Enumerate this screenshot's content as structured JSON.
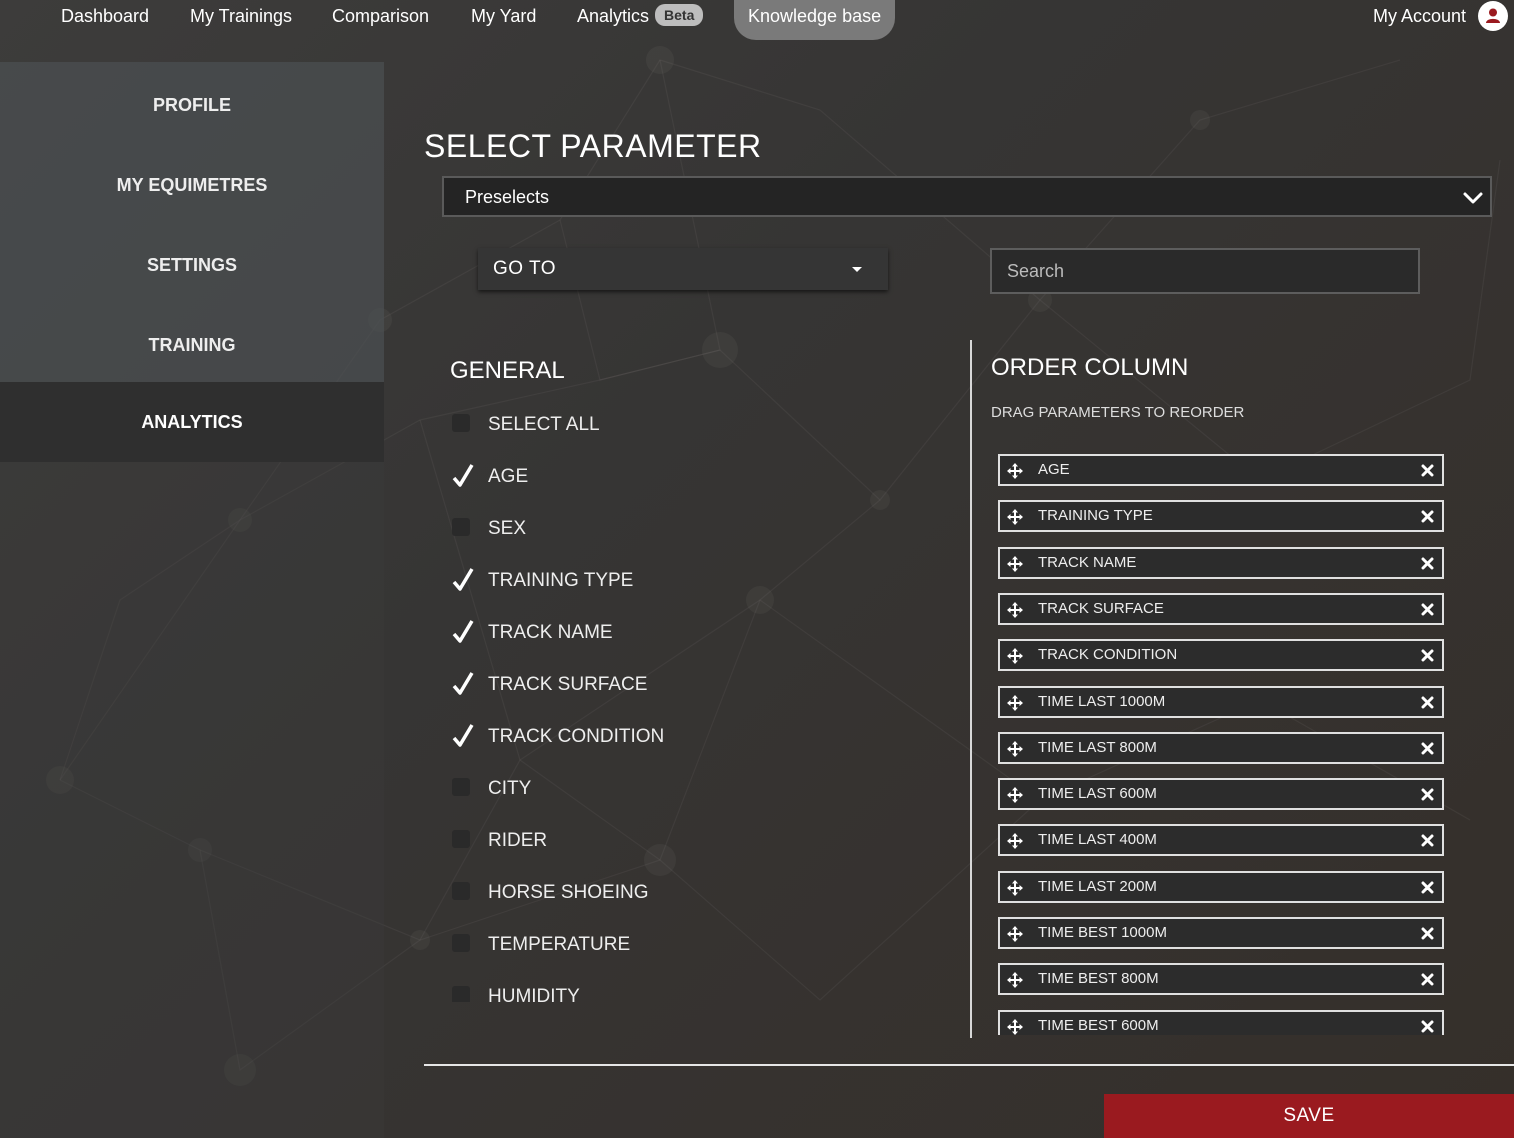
{
  "nav": {
    "items": [
      {
        "label": "Dashboard"
      },
      {
        "label": "My Trainings"
      },
      {
        "label": "Comparison"
      },
      {
        "label": "My Yard"
      },
      {
        "label": "Analytics",
        "badge": "Beta"
      },
      {
        "label": "Knowledge base"
      }
    ],
    "account_label": "My Account"
  },
  "sidebar": {
    "items": [
      {
        "label": "PROFILE"
      },
      {
        "label": "MY EQUIMETRES"
      },
      {
        "label": "SETTINGS"
      },
      {
        "label": "TRAINING"
      },
      {
        "label": "ANALYTICS"
      }
    ]
  },
  "main": {
    "title": "SELECT PARAMETER",
    "preselect": "Preselects",
    "goto": "GO TO",
    "search_placeholder": "Search",
    "general_title": "GENERAL",
    "general_items": [
      {
        "label": "SELECT ALL",
        "checked": false
      },
      {
        "label": "AGE",
        "checked": true
      },
      {
        "label": "SEX",
        "checked": false
      },
      {
        "label": "TRAINING TYPE",
        "checked": true
      },
      {
        "label": "TRACK NAME",
        "checked": true
      },
      {
        "label": "TRACK SURFACE",
        "checked": true
      },
      {
        "label": "TRACK CONDITION",
        "checked": true
      },
      {
        "label": "CITY",
        "checked": false
      },
      {
        "label": "RIDER",
        "checked": false
      },
      {
        "label": "HORSE SHOEING",
        "checked": false
      },
      {
        "label": "TEMPERATURE",
        "checked": false
      },
      {
        "label": "HUMIDITY",
        "checked": false
      }
    ],
    "order_title": "ORDER COLUMN",
    "order_subtitle": "DRAG PARAMETERS TO REORDER",
    "order_items": [
      "AGE",
      "TRAINING TYPE",
      "TRACK NAME",
      "TRACK SURFACE",
      "TRACK CONDITION",
      "TIME LAST 1000M",
      "TIME LAST 800M",
      "TIME LAST 600M",
      "TIME LAST 400M",
      "TIME LAST 200M",
      "TIME BEST 1000M",
      "TIME BEST 800M",
      "TIME BEST 600M"
    ],
    "save_label": "SAVE"
  },
  "colors": {
    "accent": "#9a1a1f",
    "active_tab": "#7a7a7a",
    "account_icon": "#9a1a1f"
  },
  "icons": {
    "move": "four-arrows-move-icon",
    "remove": "close-x-icon",
    "check": "checkmark-icon",
    "dropdown": "chevron-down-icon",
    "account": "user-icon"
  }
}
